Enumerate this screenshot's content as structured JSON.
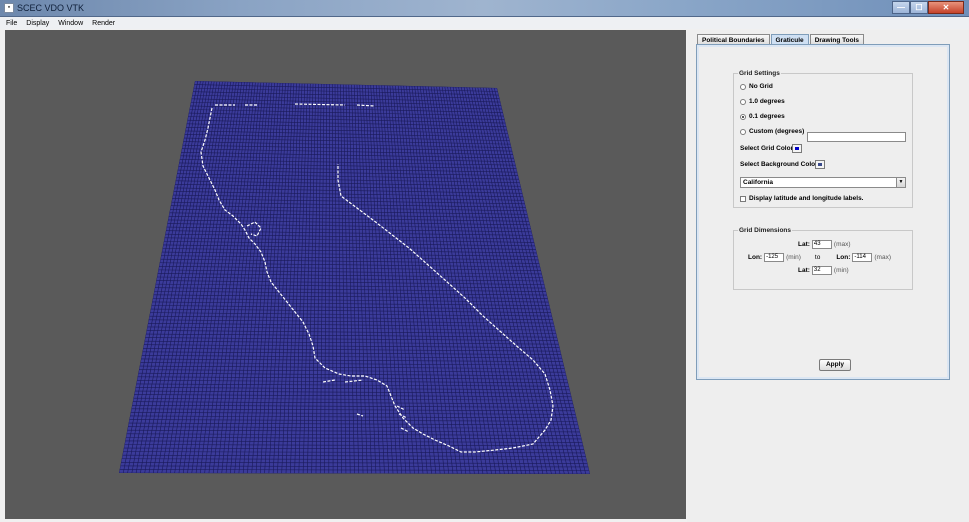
{
  "window": {
    "title": "SCEC VDO VTK",
    "controls": {
      "minimize": "—",
      "maximize": "☐",
      "close": "✕"
    }
  },
  "menu": {
    "items": [
      "File",
      "Display",
      "Window",
      "Render"
    ]
  },
  "viewport": {
    "background": "#5a5a5a",
    "grid_color": "#3b3b9a",
    "line_color": "#1a1a5a",
    "outline_color": "#ffffff"
  },
  "tabs": [
    "Political Boundaries",
    "Graticule",
    "Drawing Tools"
  ],
  "grid_settings": {
    "legend": "Grid Settings",
    "options": [
      "No Grid",
      "1.0 degrees",
      "0.1 degrees",
      "Custom (degrees)"
    ],
    "selected": "0.1 degrees",
    "custom_value": "",
    "select_grid_color_label": "Select Grid Color",
    "grid_color": "#0000c8",
    "select_background_color_label": "Select Background Color",
    "background_color": "#3a4a8a",
    "region": "California",
    "labels_checkbox": "Display latitude and longitude labels.",
    "labels_checked": false
  },
  "grid_dimensions": {
    "legend": "Grid Dimensions",
    "lat_label": "Lat:",
    "lon_label": "Lon:",
    "lat_max": "43",
    "lat_min": "32",
    "lon_min": "-125",
    "lon_max": "-114",
    "max_text": "(max)",
    "min_text": "(min)",
    "to_text": "to"
  },
  "apply_label": "Apply"
}
